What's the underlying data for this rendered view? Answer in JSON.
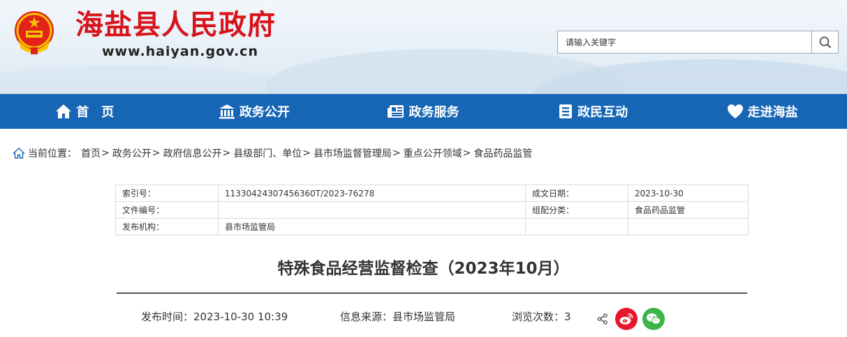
{
  "header": {
    "site_title": "海盐县人民政府",
    "site_url": "www.haiyan.gov.cn",
    "search_placeholder": "请输入关键字"
  },
  "nav": [
    {
      "label": "首　页",
      "icon": "home-icon"
    },
    {
      "label": "政务公开",
      "icon": "building-icon"
    },
    {
      "label": "政务服务",
      "icon": "newspaper-icon"
    },
    {
      "label": "政民互动",
      "icon": "list-icon"
    },
    {
      "label": "走进海盐",
      "icon": "heart-icon"
    }
  ],
  "breadcrumb": {
    "prefix": "当前位置：",
    "items": [
      "首页",
      "政务公开",
      "政府信息公开",
      "县级部门、单位",
      "县市场监督管理局",
      "重点公开领域",
      "食品药品监管"
    ],
    "separator": ">"
  },
  "meta": {
    "index_label": "索引号：",
    "index_value": "11330424307456360T/2023-76278",
    "date_label": "成文日期：",
    "date_value": "2023-10-30",
    "docno_label": "文件编号：",
    "docno_value": "",
    "category_label": "组配分类：",
    "category_value": "食品药品监管",
    "org_label": "发布机构：",
    "org_value": "县市场监管局"
  },
  "article": {
    "title": "特殊食品经营监督检查（2023年10月）",
    "publish_time": "发布时间：2023-10-30 10:39",
    "source": "信息来源：县市场监管局",
    "views": "浏览次数：3"
  },
  "colors": {
    "brand_red": "#d7141b",
    "nav_blue": "#1766b5",
    "weibo_red": "#e6162d",
    "wechat_green": "#3bb44a"
  }
}
